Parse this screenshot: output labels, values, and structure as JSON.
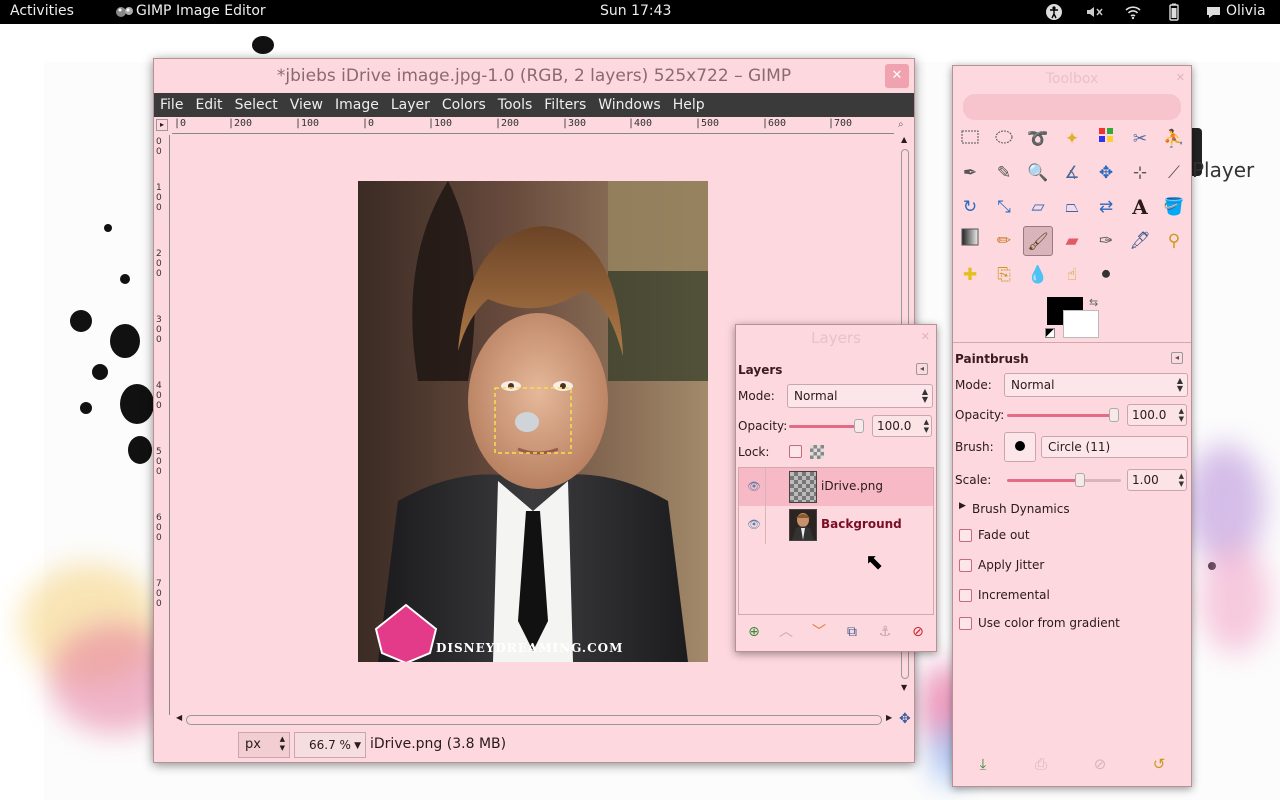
{
  "topbar": {
    "activities": "Activities",
    "app_name": "GIMP Image Editor",
    "clock": "Sun 17:43",
    "user": "Olivia"
  },
  "image_window": {
    "title": "*jbiebs iDrive image.jpg-1.0 (RGB, 2 layers) 525x722 – GIMP",
    "menu": [
      "File",
      "Edit",
      "Select",
      "View",
      "Image",
      "Layer",
      "Colors",
      "Tools",
      "Filters",
      "Windows",
      "Help"
    ],
    "ruler_h": [
      "|0",
      "|200",
      "|100",
      "|0",
      "|100",
      "|200",
      "|300",
      "|400",
      "|500",
      "|600",
      "|700"
    ],
    "ruler_v": [
      "0",
      "0",
      "1",
      "0",
      "0",
      "2",
      "0",
      "0",
      "3",
      "0",
      "0",
      "4",
      "0",
      "0",
      "5",
      "0",
      "0",
      "6",
      "0",
      "0",
      "7",
      "0",
      "0"
    ],
    "photo_caption": "DISNEYDREAMING.COM",
    "status": {
      "unit": "px",
      "zoom": "66.7 %",
      "info": "iDrive.png (3.8 MB)"
    }
  },
  "layers_dock": {
    "window_title": "Layers",
    "panel_title": "Layers",
    "mode_label": "Mode:",
    "mode_value": "Normal",
    "opacity_label": "Opacity:",
    "opacity_value": "100.0",
    "lock_label": "Lock:",
    "layers": [
      {
        "name": "iDrive.png",
        "visible": true,
        "selected": true
      },
      {
        "name": "Background",
        "visible": true,
        "selected": false
      }
    ]
  },
  "toolbox": {
    "window_title": "Toolbox",
    "tools": [
      "rect-select",
      "ellipse-select",
      "free-select",
      "fuzzy-select",
      "color-select",
      "scissors",
      "foreground-select",
      "paths",
      "color-picker",
      "zoom",
      "measure",
      "move",
      "align",
      "crop",
      "rotate",
      "scale",
      "shear",
      "perspective",
      "flip",
      "text",
      "bucket-fill",
      "blend",
      "pencil",
      "paintbrush",
      "eraser",
      "airbrush",
      "ink",
      "clone",
      "heal",
      "perspective-clone",
      "blur",
      "smudge",
      "dodge-burn"
    ],
    "active_tool": "paintbrush",
    "fg_color": "#000000",
    "bg_color": "#ffffff",
    "options": {
      "title": "Paintbrush",
      "mode_label": "Mode:",
      "mode_value": "Normal",
      "opacity_label": "Opacity:",
      "opacity_value": "100.0",
      "brush_label": "Brush:",
      "brush_value": "Circle (11)",
      "scale_label": "Scale:",
      "scale_value": "1.00",
      "dynamics": "Brush Dynamics",
      "fade_out": "Fade out",
      "apply_jitter": "Apply Jitter",
      "incremental": "Incremental",
      "use_gradient": "Use color from gradient"
    }
  },
  "desktop_text": "Player",
  "accent_color": "#e26b85"
}
